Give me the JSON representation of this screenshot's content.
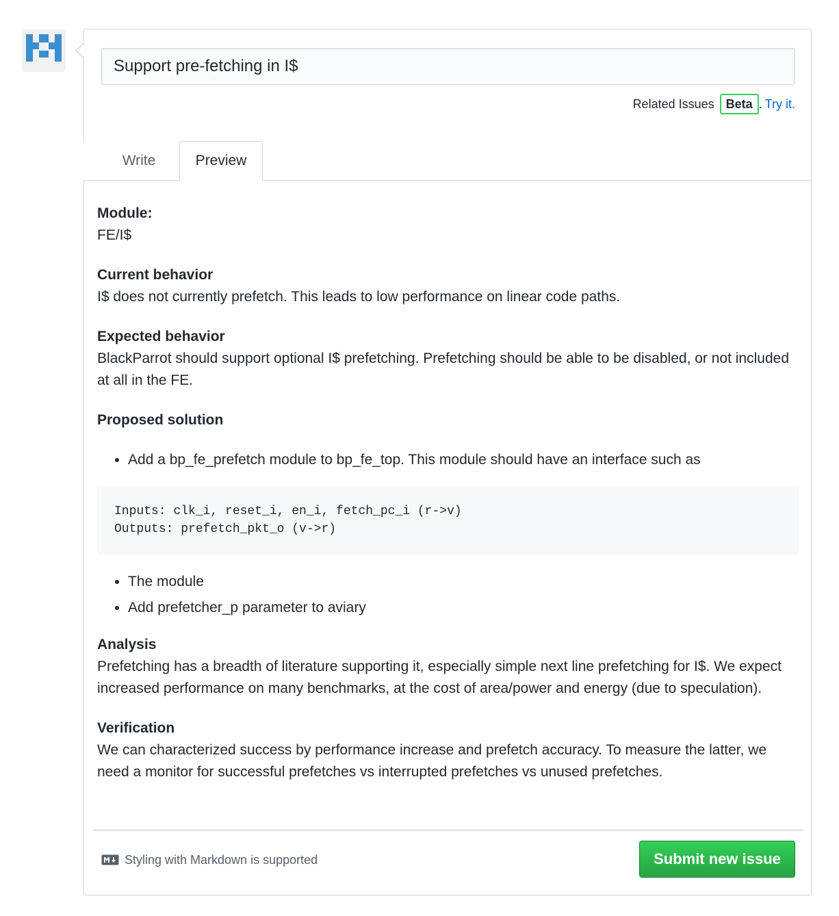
{
  "issue": {
    "title_value": "Support pre-fetching in I$"
  },
  "related": {
    "label": "Related Issues",
    "badge": "Beta",
    "separator": ".",
    "try_link": "Try it."
  },
  "tabs": [
    {
      "label": "Write",
      "active": false
    },
    {
      "label": "Preview",
      "active": true
    }
  ],
  "preview": {
    "module_heading": "Module:",
    "module_value": "FE/I$",
    "current_heading": "Current behavior",
    "current_text": "I$ does not currently prefetch. This leads to low performance on linear code paths.",
    "expected_heading": "Expected behavior",
    "expected_text": "BlackParrot should support optional I$ prefetching. Prefetching should be able to be disabled, or not included at all in the FE.",
    "proposed_heading": "Proposed solution",
    "proposed_items": [
      "Add a bp_fe_prefetch module to bp_fe_top. This module should have an interface such as"
    ],
    "code_block": "Inputs: clk_i, reset_i, en_i, fetch_pc_i (r->v)\nOutputs: prefetch_pkt_o (v->r)",
    "proposed_items_after": [
      "The module",
      "Add prefetcher_p parameter to aviary"
    ],
    "analysis_heading": "Analysis",
    "analysis_text": "Prefetching has a breadth of literature supporting it, especially simple next line prefetching for I$. We expect increased performance on many benchmarks, at the cost of area/power and energy (due to speculation).",
    "verification_heading": "Verification",
    "verification_text": "We can characterized success by performance increase and prefetch accuracy. To measure the latter, we need a monitor for successful prefetches vs interrupted prefetches vs unused prefetches."
  },
  "footer": {
    "markdown_note": "Styling with Markdown is supported",
    "submit_label": "Submit new issue"
  },
  "colors": {
    "accent_link": "#0366d6",
    "submit_green": "#28a745",
    "avatar_blue": "#3d8bd6"
  }
}
